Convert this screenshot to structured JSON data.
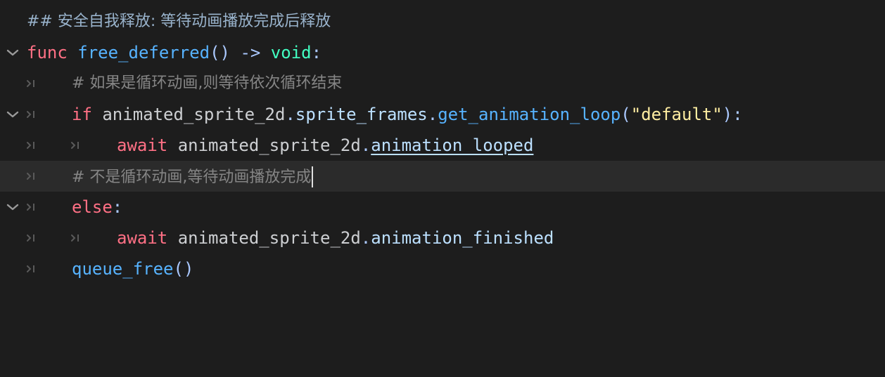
{
  "colors": {
    "background": "#1d1d1d",
    "current_line": "#2b2b2b",
    "keyword": "#ff7085",
    "function": "#57b3ff",
    "type": "#42ffc2",
    "string": "#ffeda1",
    "comment": "#858585",
    "doc_comment": "#99b3cc",
    "member": "#bce0ff"
  },
  "icons": {
    "fold": "chevron-down-icon",
    "tab": "tab-indent-icon"
  },
  "lines": {
    "l1": {
      "doc_comment": "## 安全自我释放: 等待动画播放完成后释放"
    },
    "l2": {
      "kw_func": "func",
      "fn_name": "free_deferred",
      "parens": "()",
      "arrow": " -> ",
      "ret_type": "void",
      "colon": ":"
    },
    "l3": {
      "comment": "# 如果是循环动画,则等待依次循环结束"
    },
    "l4": {
      "kw_if": "if",
      "obj": "animated_sprite_2d",
      "dot1": ".",
      "prop": "sprite_frames",
      "dot2": ".",
      "method": "get_animation_loop",
      "open": "(",
      "arg": "\"default\"",
      "close": "):"
    },
    "l5": {
      "kw_await": "await",
      "obj": "animated_sprite_2d",
      "dot": ".",
      "signal": "animation_looped"
    },
    "l6": {
      "comment": "# 不是循环动画,等待动画播放完成"
    },
    "l7": {
      "kw_else": "else",
      "colon": ":"
    },
    "l8": {
      "kw_await": "await",
      "obj": "animated_sprite_2d",
      "dot": ".",
      "signal": "animation_finished"
    },
    "l9": {
      "fn": "queue_free",
      "parens": "()"
    }
  }
}
